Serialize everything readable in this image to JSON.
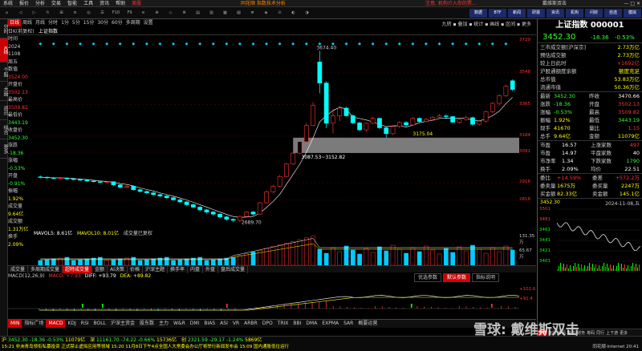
{
  "menubar": {
    "items": [
      "系统",
      "报价",
      "分析",
      "交易",
      "智能",
      "工具",
      "资讯",
      "帮助",
      "美股"
    ],
    "center_brand": "同花顺 指数技术分析",
    "right_notice": "注意, 机构介入你的票...",
    "right_link": "戴维斯双击"
  },
  "toolbar": {
    "buttons": [
      "⌂",
      "◁",
      "▷",
      "↻",
      "⊞",
      "≡",
      "◎",
      "☰",
      "F10",
      "F9",
      "≋",
      "⊕",
      "◇",
      "⊗",
      "▤",
      "▥",
      "▦",
      "▧",
      "≣",
      "◈",
      "⊙",
      "◐",
      "◑"
    ],
    "right_buttons": [
      "数据",
      "BTF",
      "新闻",
      "研报",
      "资讯",
      "机构",
      "问财",
      "自选",
      "模拟"
    ]
  },
  "leftnav": [
    "分时",
    "K线",
    "个股",
    "大盘",
    "资讯",
    "综合",
    "更多"
  ],
  "chart_header": {
    "period_tabs": [
      "日线",
      "周线",
      "月线",
      "分时",
      "1分",
      "5分",
      "15分",
      "30分",
      "60分",
      "多周期",
      "设置"
    ],
    "left_label": "日K(前复权)",
    "index_label": "上证指数",
    "right_tools": "九转 ▪ 叠加 ▪ 统计 ▪ 画线 ▪ 区间 ▪ 更多"
  },
  "infopanel": {
    "rows": [
      {
        "k": "时间",
        "v": "",
        "c": "r"
      },
      {
        "k": "2024",
        "v": "",
        "c": "r"
      },
      {
        "k": "1108",
        "v": "",
        "c": "r"
      },
      {
        "k": "周五",
        "v": "",
        "c": "r"
      },
      {
        "k": "数值",
        "v": "",
        "c": "r"
      },
      {
        "k": "3524.00",
        "v": "",
        "c": "rd"
      },
      {
        "k": "开盘价",
        "v": "",
        "c": "r"
      },
      {
        "k": "3502.13",
        "v": "",
        "c": "rd"
      },
      {
        "k": "最高价",
        "v": "",
        "c": "r"
      },
      {
        "k": "3509.82",
        "v": "",
        "c": "rd"
      },
      {
        "k": "最低价",
        "v": "",
        "c": "r"
      },
      {
        "k": "3443.19",
        "v": "",
        "c": "g"
      },
      {
        "k": "收盘价",
        "v": "",
        "c": "r"
      },
      {
        "k": "3452.30",
        "v": "",
        "c": "g"
      },
      {
        "k": "涨跌",
        "v": "",
        "c": "r"
      },
      {
        "k": "-18.36",
        "v": "",
        "c": "g"
      },
      {
        "k": "涨幅",
        "v": "",
        "c": "r"
      },
      {
        "k": "-0.53%",
        "v": "",
        "c": "g"
      },
      {
        "k": "开盘",
        "v": "",
        "c": "r"
      },
      {
        "k": "-0.91%",
        "v": "",
        "c": "g"
      },
      {
        "k": "振幅",
        "v": "",
        "c": "r"
      },
      {
        "k": "1.92%",
        "v": "",
        "c": "y"
      },
      {
        "k": "成交量",
        "v": "",
        "c": "r"
      },
      {
        "k": "9.64亿",
        "v": "",
        "c": "y"
      },
      {
        "k": "成交额",
        "v": "",
        "c": "r"
      },
      {
        "k": "1.31万亿",
        "v": "",
        "c": "y"
      },
      {
        "k": "换手",
        "v": "",
        "c": "r"
      },
      {
        "k": "2.09%",
        "v": "",
        "c": "y"
      }
    ]
  },
  "main_chart": {
    "price_axis": [
      "3729",
      "3548",
      "3365",
      "3184",
      "3091",
      "2916",
      "2816"
    ],
    "annotations": {
      "high": "3674.40",
      "mid": "3175.04",
      "low": "2689.70",
      "gap": "3087.53~3152.82"
    }
  },
  "vol_legend": {
    "mavol5": "MAVOL5: 8.61亿",
    "mavol10": "MAVOL10: 8.01亿",
    "state": "成交量已复权"
  },
  "vol_axis": [
    "131.35万",
    "65.67万"
  ],
  "macd_legend": {
    "title": "MACD(12,26,9)",
    "macd": "MACD: +7.93",
    "diff": "DIFF: +93.79",
    "dea": "DEA: +89.82"
  },
  "macd_axis": [
    "+102.6",
    "+91.4"
  ],
  "macd_buttons": [
    "优选参数",
    "默认参数",
    "指标说明"
  ],
  "vol_tabs": [
    "成交量",
    "多周期成交量",
    "超特成交量",
    "金额",
    "AI决策",
    "价格",
    "沪深主题",
    "换手率",
    "内盘",
    "外盘",
    "盘后成交量"
  ],
  "bottom_tabs": [
    "MIN",
    "指标广场",
    "MACD",
    "KDJ",
    "RSI",
    "BOLL",
    "沪深主资金",
    "股东数",
    "主力",
    "W&R",
    "DMI",
    "BIAS",
    "ASI",
    "VR",
    "ARBR",
    "DPO",
    "TRIX",
    "BBI",
    "DMA",
    "EXPMA",
    "SAR",
    "概要运营"
  ],
  "statusbar": {
    "left": "沪",
    "price": "3452.30",
    "chg": "-18.36",
    "pct": "-0.53%",
    "vol": "11079亿",
    "sz_label": "深",
    "sz_price": "11161.70",
    "sz_chg": "-74.22",
    "sz_pct": "-0.66%",
    "sz_vol": "15736亿",
    "cyb_label": "创",
    "cyb_price": "2321.59",
    "cyb_chg": "-29.17",
    "cyb_pct": "-1.24%",
    "cyb_vol": "5869亿",
    "news": "15:21 非洲青岛领衔私募投资 正式禁止虚拟应用等领域 15:20 11月8日下午4点全国人大常委会办公厅将举行新闻发布会 15:09 国内通胀低位运行",
    "right": "同花顺·Internet 20:41",
    "watermark": "雪球: 戴维斯双击"
  },
  "rightpanel": {
    "title": "上证指数 000001",
    "price": "3452.30",
    "chg": "-18.36",
    "pct": "-0.53%",
    "rows": [
      {
        "k": "三市成交额[沪深京]",
        "v": "2.73万亿",
        "vc": "yellow"
      },
      {
        "k": "预估成交额",
        "v": "2.73万亿",
        "vc": "yellow"
      },
      {
        "k": "较上日此时",
        "v": "+1692亿",
        "vc": "red"
      },
      {
        "k": "沪股通额度余额",
        "v": "额度充足",
        "vc": "yellow"
      },
      {
        "k": "总市值",
        "v": "53.83万亿",
        "vc": "yellow"
      },
      {
        "k": "流通市值",
        "v": "50.36万亿",
        "vc": "yellow"
      }
    ],
    "quote": [
      {
        "k": "最新",
        "v": "3452.30",
        "vc": "green",
        "k2": "昨收",
        "v2": "3470.66",
        "v2c": "white"
      },
      {
        "k": "涨跌",
        "v": "-18.36",
        "vc": "green",
        "k2": "开盘",
        "v2": "3502.13",
        "v2c": "red"
      },
      {
        "k": "涨幅",
        "v": "-0.53%",
        "vc": "green",
        "k2": "最高",
        "v2": "3509.82",
        "v2c": "red"
      },
      {
        "k": "振幅",
        "v": "1.92%",
        "vc": "yellow",
        "k2": "最低",
        "v2": "3443.19",
        "v2c": "green"
      },
      {
        "k": "现手",
        "v": "41670",
        "vc": "yellow",
        "k2": "量比",
        "v2": "1.15",
        "v2c": "red"
      },
      {
        "k": "总手",
        "v": "9.64亿",
        "vc": "yellow",
        "k2": "金额",
        "v2": "11079亿",
        "v2c": "yellow"
      }
    ],
    "stats": [
      {
        "k": "市盈",
        "v": "16.57",
        "k2": "上涨家数",
        "v2": "497"
      },
      {
        "k": "市盈",
        "v": "14.97",
        "k2": "平盘家数",
        "v2": "40"
      },
      {
        "k": "市净率",
        "v": "1.34",
        "k2": "下跌家数",
        "v2": "1790"
      },
      {
        "k": "换手",
        "v": "2.09%",
        "k2": "均价",
        "v2": "22.51"
      }
    ],
    "wb": [
      {
        "k": "委比",
        "v": "+14.59%",
        "k2": "委差",
        "v2": "+572.2万"
      },
      {
        "k": "委卖量",
        "v": "1675万",
        "k2": "委买量",
        "v2": "2247万"
      },
      {
        "k": "买金额",
        "v": "82.33亿",
        "k2": "卖金额",
        "v2": "145.1亿"
      }
    ],
    "mini": {
      "title": "3452.30",
      "date": "2024-11-08,五",
      "axis": [
        "3501",
        "3481",
        "3461",
        "3441",
        "3421",
        "3401"
      ],
      "tabs": [
        "分时",
        "盘后",
        "资讯",
        "量价",
        "财务",
        "筹码",
        "同行",
        "上下游",
        "更多"
      ]
    }
  },
  "colors": {
    "up": "#ff3333",
    "down": "#00ffff",
    "accent": "#cc0000",
    "bg": "#000000"
  },
  "candles": [
    {
      "o": 2950,
      "c": 2948,
      "h": 2958,
      "l": 2942
    },
    {
      "o": 2948,
      "c": 2944,
      "h": 2952,
      "l": 2938
    },
    {
      "o": 2944,
      "c": 2941,
      "h": 2950,
      "l": 2935
    },
    {
      "o": 2941,
      "c": 2943,
      "h": 2950,
      "l": 2936
    },
    {
      "o": 2943,
      "c": 2938,
      "h": 2947,
      "l": 2932
    },
    {
      "o": 2938,
      "c": 2935,
      "h": 2944,
      "l": 2930
    },
    {
      "o": 2935,
      "c": 2931,
      "h": 2940,
      "l": 2926
    },
    {
      "o": 2931,
      "c": 2926,
      "h": 2935,
      "l": 2920
    },
    {
      "o": 2926,
      "c": 2922,
      "h": 2932,
      "l": 2918
    },
    {
      "o": 2922,
      "c": 2918,
      "h": 2928,
      "l": 2912
    },
    {
      "o": 2918,
      "c": 2922,
      "h": 2926,
      "l": 2912
    },
    {
      "o": 2922,
      "c": 2904,
      "h": 2925,
      "l": 2898
    },
    {
      "o": 2904,
      "c": 2890,
      "h": 2908,
      "l": 2883
    },
    {
      "o": 2890,
      "c": 2896,
      "h": 2902,
      "l": 2884
    },
    {
      "o": 2896,
      "c": 2876,
      "h": 2900,
      "l": 2870
    },
    {
      "o": 2876,
      "c": 2866,
      "h": 2882,
      "l": 2860
    },
    {
      "o": 2866,
      "c": 2858,
      "h": 2872,
      "l": 2852
    },
    {
      "o": 2858,
      "c": 2848,
      "h": 2864,
      "l": 2842
    },
    {
      "o": 2848,
      "c": 2840,
      "h": 2853,
      "l": 2834
    },
    {
      "o": 2840,
      "c": 2830,
      "h": 2845,
      "l": 2824
    },
    {
      "o": 2830,
      "c": 2818,
      "h": 2836,
      "l": 2812
    },
    {
      "o": 2818,
      "c": 2806,
      "h": 2824,
      "l": 2800
    },
    {
      "o": 2806,
      "c": 2790,
      "h": 2810,
      "l": 2784
    },
    {
      "o": 2790,
      "c": 2776,
      "h": 2796,
      "l": 2770
    },
    {
      "o": 2776,
      "c": 2760,
      "h": 2782,
      "l": 2752
    },
    {
      "o": 2760,
      "c": 2748,
      "h": 2766,
      "l": 2740
    },
    {
      "o": 2748,
      "c": 2736,
      "h": 2754,
      "l": 2728
    },
    {
      "o": 2736,
      "c": 2720,
      "h": 2740,
      "l": 2712
    },
    {
      "o": 2720,
      "c": 2706,
      "h": 2726,
      "l": 2698
    },
    {
      "o": 2706,
      "c": 2700,
      "h": 2712,
      "l": 2690
    },
    {
      "o": 2700,
      "c": 2722,
      "h": 2728,
      "l": 2689
    },
    {
      "o": 2722,
      "c": 2748,
      "h": 2752,
      "l": 2718
    },
    {
      "o": 2748,
      "c": 2736,
      "h": 2754,
      "l": 2728
    },
    {
      "o": 2736,
      "c": 2801,
      "h": 2806,
      "l": 2730
    },
    {
      "o": 2801,
      "c": 2864,
      "h": 2872,
      "l": 2796
    },
    {
      "o": 2864,
      "c": 2896,
      "h": 2904,
      "l": 2858
    },
    {
      "o": 2896,
      "c": 2952,
      "h": 2960,
      "l": 2890
    },
    {
      "o": 2952,
      "c": 3024,
      "h": 3030,
      "l": 2948
    },
    {
      "o": 3024,
      "c": 3086,
      "h": 3092,
      "l": 3018
    },
    {
      "o": 3086,
      "c": 3152,
      "h": 3156,
      "l": 3080
    },
    {
      "o": 3152,
      "c": 3245,
      "h": 3260,
      "l": 3146
    },
    {
      "o": 3245,
      "c": 3360,
      "h": 3380,
      "l": 3240
    },
    {
      "o": 3610,
      "c": 3489,
      "h": 3674,
      "l": 3430
    },
    {
      "o": 3489,
      "c": 3258,
      "h": 3500,
      "l": 3230
    },
    {
      "o": 3258,
      "c": 3300,
      "h": 3340,
      "l": 3200
    },
    {
      "o": 3300,
      "c": 3345,
      "h": 3360,
      "l": 3270
    },
    {
      "o": 3345,
      "c": 3301,
      "h": 3352,
      "l": 3296
    },
    {
      "o": 3301,
      "c": 3260,
      "h": 3310,
      "l": 3252
    },
    {
      "o": 3260,
      "c": 3220,
      "h": 3268,
      "l": 3212
    },
    {
      "o": 3220,
      "c": 3258,
      "h": 3262,
      "l": 3210
    },
    {
      "o": 3258,
      "c": 3286,
      "h": 3296,
      "l": 3250
    },
    {
      "o": 3286,
      "c": 3232,
      "h": 3290,
      "l": 3224
    },
    {
      "o": 3232,
      "c": 3198,
      "h": 3240,
      "l": 3175
    },
    {
      "o": 3198,
      "c": 3240,
      "h": 3246,
      "l": 3190
    },
    {
      "o": 3240,
      "c": 3262,
      "h": 3270,
      "l": 3230
    },
    {
      "o": 3262,
      "c": 3248,
      "h": 3270,
      "l": 3240
    },
    {
      "o": 3248,
      "c": 3286,
      "h": 3292,
      "l": 3244
    },
    {
      "o": 3286,
      "c": 3268,
      "h": 3292,
      "l": 3260
    },
    {
      "o": 3268,
      "c": 3280,
      "h": 3288,
      "l": 3262
    },
    {
      "o": 3280,
      "c": 3292,
      "h": 3298,
      "l": 3274
    },
    {
      "o": 3292,
      "c": 3300,
      "h": 3312,
      "l": 3288
    },
    {
      "o": 3300,
      "c": 3296,
      "h": 3310,
      "l": 3286
    },
    {
      "o": 3296,
      "c": 3264,
      "h": 3300,
      "l": 3258
    },
    {
      "o": 3264,
      "c": 3280,
      "h": 3290,
      "l": 3256
    },
    {
      "o": 3280,
      "c": 3290,
      "h": 3302,
      "l": 3272
    },
    {
      "o": 3290,
      "c": 3252,
      "h": 3296,
      "l": 3244
    },
    {
      "o": 3252,
      "c": 3270,
      "h": 3276,
      "l": 3246
    },
    {
      "o": 3270,
      "c": 3325,
      "h": 3332,
      "l": 3262
    },
    {
      "o": 3325,
      "c": 3372,
      "h": 3380,
      "l": 3316
    },
    {
      "o": 3372,
      "c": 3416,
      "h": 3424,
      "l": 3360
    },
    {
      "o": 3416,
      "c": 3470,
      "h": 3480,
      "l": 3410
    },
    {
      "o": 3502,
      "c": 3452,
      "h": 3510,
      "l": 3443
    }
  ]
}
